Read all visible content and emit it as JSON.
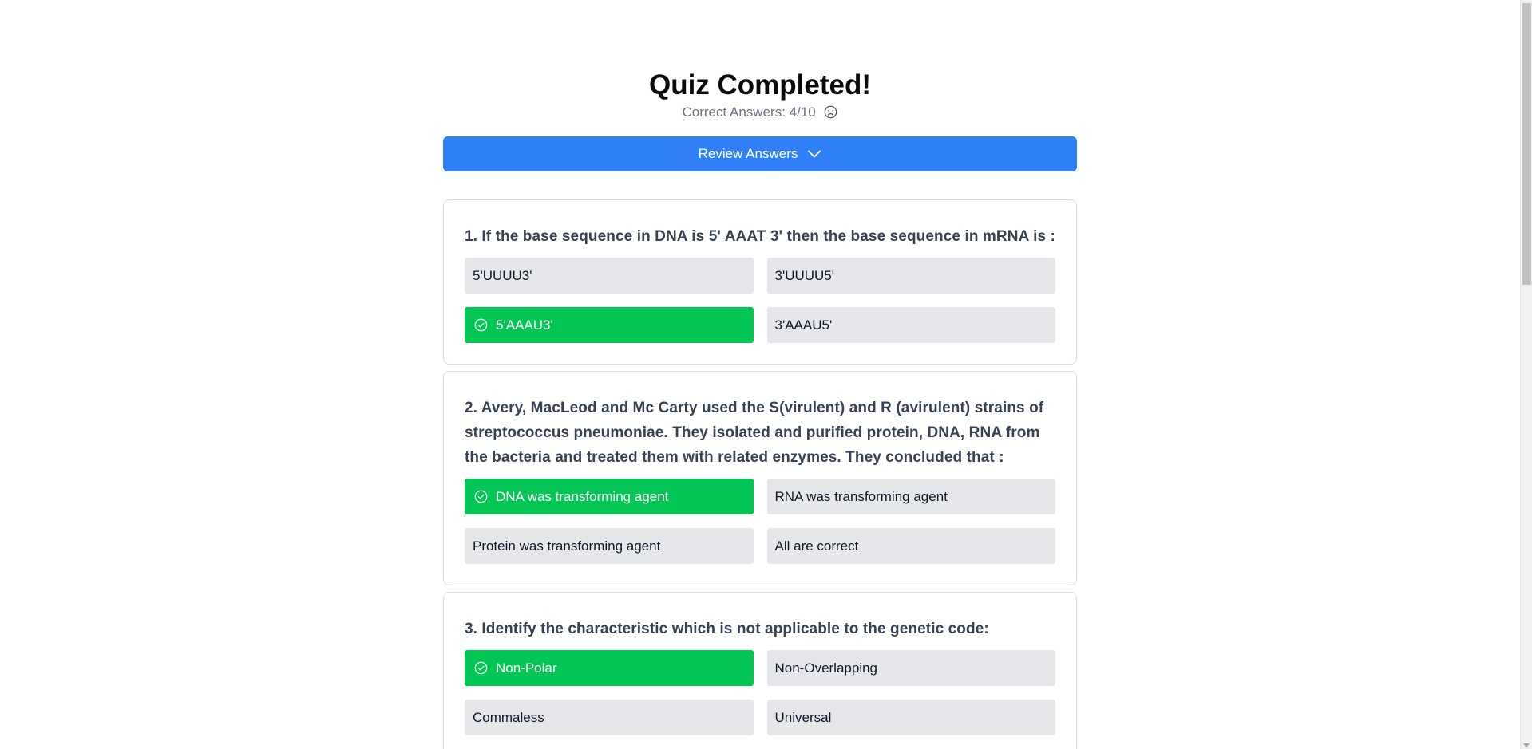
{
  "header": {
    "title": "Quiz Completed!",
    "score_text": "Correct Answers: 4/10",
    "score_icon": "sad-face-icon"
  },
  "review_button": {
    "label": "Review Answers",
    "icon": "chevron-down-icon"
  },
  "colors": {
    "primary": "#2f7ff6",
    "correct": "#04c654",
    "option_bg": "#e5e7eb"
  },
  "questions": [
    {
      "text": "1. If the base sequence in DNA is 5' AAAT 3' then the base sequence in mRNA is :",
      "options": [
        {
          "label": "5'UUUU3'",
          "correct": false
        },
        {
          "label": "3'UUUU5'",
          "correct": false
        },
        {
          "label": "5'AAAU3'",
          "correct": true
        },
        {
          "label": "3'AAAU5'",
          "correct": false
        }
      ]
    },
    {
      "text": "2. Avery, MacLeod and Mc Carty used the S(virulent) and R (avirulent) strains of streptococcus pneumoniae. They isolated and purified protein, DNA, RNA from the bacteria and treated them with related enzymes. They concluded that :",
      "options": [
        {
          "label": "DNA was transforming agent",
          "correct": true
        },
        {
          "label": "RNA was transforming agent",
          "correct": false
        },
        {
          "label": "Protein was transforming agent",
          "correct": false
        },
        {
          "label": "All are correct",
          "correct": false
        }
      ]
    },
    {
      "text": "3. Identify the characteristic which is not applicable to the genetic code:",
      "options": [
        {
          "label": "Non-Polar",
          "correct": true
        },
        {
          "label": "Non-Overlapping",
          "correct": false
        },
        {
          "label": "Commaless",
          "correct": false
        },
        {
          "label": "Universal",
          "correct": false
        }
      ]
    }
  ]
}
